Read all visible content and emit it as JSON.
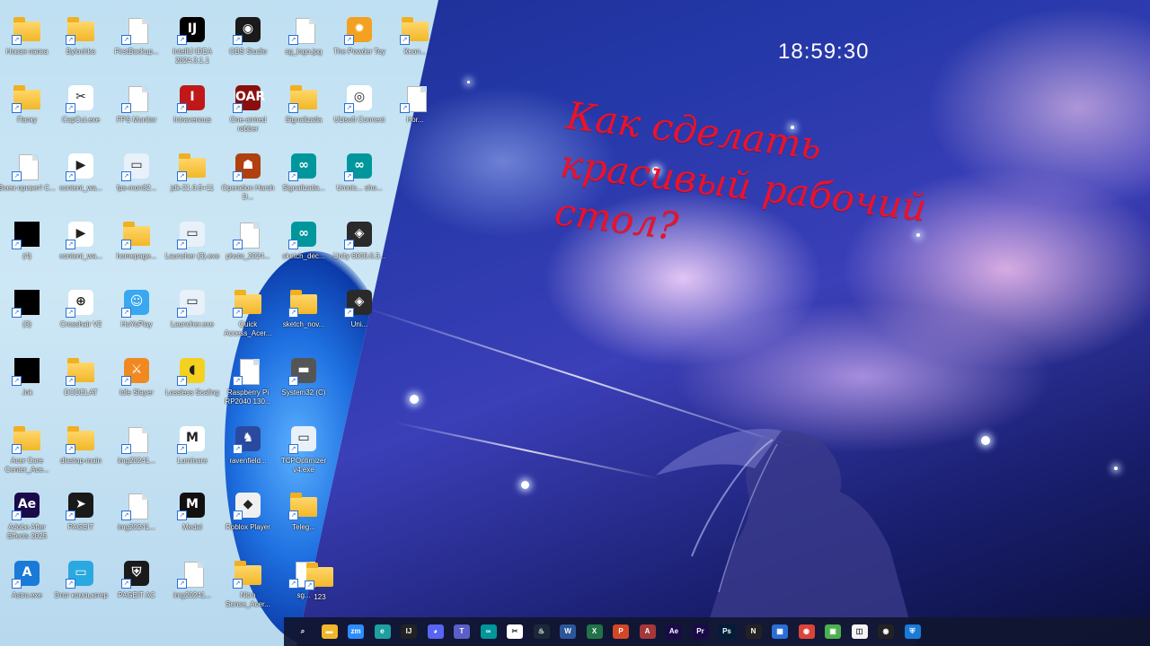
{
  "clock": {
    "time": "18:59:30"
  },
  "headline": {
    "line1": "Как сделать",
    "line2": "красивый рабочий",
    "line3": "стол?"
  },
  "colors": {
    "headline": "#e8132c",
    "folder": "#f2b728",
    "taskbar": "#101630"
  },
  "desktop_icons": [
    {
      "label": "Новая папка",
      "kind": "folder",
      "icon": "folder-icon"
    },
    {
      "label": "Bylochka",
      "kind": "folder",
      "icon": "folder-icon"
    },
    {
      "label": "FirstBackup...",
      "kind": "file",
      "icon": "file-icon"
    },
    {
      "label": "IntelliJ IDEA 2024.3.1.1",
      "kind": "app",
      "icon": "intellij-icon",
      "color": "#000000",
      "glyph": "IJ"
    },
    {
      "label": "OBS Studio",
      "kind": "app",
      "icon": "obs-icon",
      "color": "#1a1a1a",
      "glyph": "◉"
    },
    {
      "label": "sg_logo.jpg",
      "kind": "file",
      "icon": "image-file-icon"
    },
    {
      "label": "The Powder Toy",
      "kind": "app",
      "icon": "powder-toy-icon",
      "color": "#f4a020",
      "glyph": "✹"
    },
    {
      "label": "Кноп...",
      "kind": "folder",
      "icon": "folder-icon"
    },
    {
      "label": "Папку",
      "kind": "folder",
      "icon": "folder-icon"
    },
    {
      "label": "CapCut.exe",
      "kind": "app",
      "icon": "capcut-icon",
      "color": "#ffffff",
      "glyph": "✂"
    },
    {
      "label": "FPS Monitor",
      "kind": "file",
      "icon": "file-icon"
    },
    {
      "label": "Intravenous",
      "kind": "app",
      "icon": "intravenous-icon",
      "color": "#c01818",
      "glyph": "I"
    },
    {
      "label": "One-armed robber",
      "kind": "app",
      "icon": "robber-icon",
      "color": "#8a1010",
      "glyph": "OAR"
    },
    {
      "label": "Signalizatia",
      "kind": "folder",
      "icon": "folder-icon"
    },
    {
      "label": "Ubisoft Connect",
      "kind": "app",
      "icon": "ubisoft-icon",
      "color": "#ffffff",
      "glyph": "◎"
    },
    {
      "label": "Hor...",
      "kind": "file",
      "icon": "file-icon"
    },
    {
      "label": "Всем привет! С...",
      "kind": "file",
      "icon": "text-file-icon"
    },
    {
      "label": "content_wa...",
      "kind": "app",
      "icon": "video-icon",
      "color": "#ffffff",
      "glyph": "▶"
    },
    {
      "label": "fps-mon32...",
      "kind": "app",
      "icon": "exe-icon",
      "color": "#e8f0fa",
      "glyph": "▭"
    },
    {
      "label": "jdk-21.0.5+11",
      "kind": "folder",
      "icon": "folder-icon"
    },
    {
      "label": "Operation Harsh D...",
      "kind": "app",
      "icon": "operation-icon",
      "color": "#b04010",
      "glyph": "☗"
    },
    {
      "label": "Signalizatia...",
      "kind": "app",
      "icon": "arduino-icon",
      "color": "#00979c",
      "glyph": "∞"
    },
    {
      "label": "Umnic... sho...",
      "kind": "app",
      "icon": "arduino-icon",
      "color": "#00979c",
      "glyph": "∞"
    },
    {
      "label": "(4)",
      "kind": "black",
      "icon": "black-square-icon"
    },
    {
      "label": "content_wa...",
      "kind": "app",
      "icon": "video-icon",
      "color": "#ffffff",
      "glyph": "▶"
    },
    {
      "label": "homepage...",
      "kind": "folder",
      "icon": "folder-icon"
    },
    {
      "label": "Launcher (3).exe",
      "kind": "app",
      "icon": "exe-icon",
      "color": "#e8f0fa",
      "glyph": "▭"
    },
    {
      "label": "photo_2024...",
      "kind": "file",
      "icon": "image-file-icon"
    },
    {
      "label": "sketch_dec...",
      "kind": "app",
      "icon": "arduino-icon",
      "color": "#00979c",
      "glyph": "∞"
    },
    {
      "label": "Unity 6000.0.3...",
      "kind": "app",
      "icon": "unity-icon",
      "color": "#2a2a2a",
      "glyph": "◈"
    },
    {
      "label": "(3)",
      "kind": "black",
      "icon": "black-square-icon"
    },
    {
      "label": "Crosshair V2",
      "kind": "app",
      "icon": "crosshair-icon",
      "color": "#ffffff",
      "glyph": "⊕"
    },
    {
      "label": "HoYoPlay",
      "kind": "app",
      "icon": "hoyoplay-icon",
      "color": "#39a8f0",
      "glyph": "☺"
    },
    {
      "label": "Launcher.exe",
      "kind": "app",
      "icon": "exe-icon",
      "color": "#e8f0fa",
      "glyph": "▭"
    },
    {
      "label": "Quick Access_Acer...",
      "kind": "folder",
      "icon": "folder-icon"
    },
    {
      "label": "sketch_nov...",
      "kind": "folder",
      "icon": "folder-icon"
    },
    {
      "label": "Uni...",
      "kind": "app",
      "icon": "unity-icon",
      "color": "#2a2a2a",
      "glyph": "◈"
    },
    {
      "label": ".lnk",
      "kind": "black",
      "icon": "black-square-icon"
    },
    {
      "label": "DODELAT",
      "kind": "folder",
      "icon": "folder-icon"
    },
    {
      "label": "Idle Slayer",
      "kind": "app",
      "icon": "idle-slayer-icon",
      "color": "#f08a20",
      "glyph": "⚔"
    },
    {
      "label": "Lossless Scaling",
      "kind": "app",
      "icon": "duck-icon",
      "color": "#f4d020",
      "glyph": "◖"
    },
    {
      "label": "Raspberry Pi RP2040 130...",
      "kind": "file",
      "icon": "text-file-icon"
    },
    {
      "label": "System32 (C)",
      "kind": "app",
      "icon": "drive-icon",
      "color": "#555555",
      "glyph": "▬"
    },
    {
      "label": "Acer Care Center_Ace...",
      "kind": "folder",
      "icon": "folder-icon"
    },
    {
      "label": "diastop-main",
      "kind": "folder",
      "icon": "folder-icon"
    },
    {
      "label": "img20241...",
      "kind": "file",
      "icon": "image-file-icon"
    },
    {
      "label": "Luminare",
      "kind": "app",
      "icon": "luminare-icon",
      "color": "#ffffff",
      "glyph": "M"
    },
    {
      "label": "ravenfield...",
      "kind": "app",
      "icon": "ravenfield-icon",
      "color": "#2a4aa0",
      "glyph": "♞"
    },
    {
      "label": "TCPOptimizer v4.exe",
      "kind": "app",
      "icon": "exe-icon",
      "color": "#e8f0fa",
      "glyph": "▭"
    },
    {
      "label": "Adobe After Effects 2025",
      "kind": "app",
      "icon": "after-effects-icon",
      "color": "#1a0a4a",
      "glyph": "Ae"
    },
    {
      "label": "PAGEIT",
      "kind": "app",
      "icon": "pageit-icon",
      "color": "#1a1a1a",
      "glyph": "➤"
    },
    {
      "label": "img20241...",
      "kind": "file",
      "icon": "image-file-icon"
    },
    {
      "label": "Medal",
      "kind": "app",
      "icon": "medal-icon",
      "color": "#111111",
      "glyph": "M"
    },
    {
      "label": "Roblox Player",
      "kind": "app",
      "icon": "roblox-icon",
      "color": "#f0f0f0",
      "glyph": "◆"
    },
    {
      "label": "Teleg...",
      "kind": "folder",
      "icon": "folder-icon"
    },
    {
      "label": "Astro.exe",
      "kind": "app",
      "icon": "astro-icon",
      "color": "#1a7ad8",
      "glyph": "A"
    },
    {
      "label": "Этот компьютер",
      "kind": "app",
      "icon": "this-pc-icon",
      "color": "#2aa8e0",
      "glyph": "▭"
    },
    {
      "label": "PAGEIT AC",
      "kind": "app",
      "icon": "pageit-ac-icon",
      "color": "#1a1a1a",
      "glyph": "⛨"
    },
    {
      "label": "img20241...",
      "kind": "file",
      "icon": "image-file-icon"
    },
    {
      "label": "Nitro Sense_Acer...",
      "kind": "folder",
      "icon": "folder-icon"
    },
    {
      "label": "sg...",
      "kind": "file",
      "icon": "file-icon"
    },
    {
      "label": "123",
      "kind": "folder",
      "icon": "folder-icon"
    }
  ],
  "taskbar": [
    {
      "name": "search-icon",
      "glyph": "⌕",
      "color": "transparent"
    },
    {
      "name": "file-explorer-icon",
      "glyph": "▬",
      "color": "#f2b728"
    },
    {
      "name": "zoom-icon",
      "glyph": "zm",
      "color": "#2d8cff"
    },
    {
      "name": "edge-icon",
      "glyph": "e",
      "color": "#1fa0a0"
    },
    {
      "name": "intellij-icon",
      "glyph": "IJ",
      "color": "#222222"
    },
    {
      "name": "discord-icon",
      "glyph": "◕",
      "color": "#5865f2"
    },
    {
      "name": "teams-icon",
      "glyph": "T",
      "color": "#5b5fc7"
    },
    {
      "name": "arduino-icon",
      "glyph": "∞",
      "color": "#00979c"
    },
    {
      "name": "capcut-icon",
      "glyph": "✂",
      "color": "#ffffff"
    },
    {
      "name": "steam-icon",
      "glyph": "♨",
      "color": "#1b2838"
    },
    {
      "name": "word-icon",
      "glyph": "W",
      "color": "#2b579a"
    },
    {
      "name": "excel-icon",
      "glyph": "X",
      "color": "#217346"
    },
    {
      "name": "powerpoint-icon",
      "glyph": "P",
      "color": "#d24726"
    },
    {
      "name": "access-icon",
      "glyph": "A",
      "color": "#a4373a"
    },
    {
      "name": "after-effects-icon",
      "glyph": "Ae",
      "color": "#1a0a4a"
    },
    {
      "name": "premiere-icon",
      "glyph": "Pr",
      "color": "#1a0a4a"
    },
    {
      "name": "photoshop-icon",
      "glyph": "Ps",
      "color": "#001e36"
    },
    {
      "name": "notion-icon",
      "glyph": "N",
      "color": "#222222"
    },
    {
      "name": "widgets-icon",
      "glyph": "▦",
      "color": "#2a6fd6"
    },
    {
      "name": "chrome-icon",
      "glyph": "◉",
      "color": "#db4437"
    },
    {
      "name": "minecraft-icon",
      "glyph": "▣",
      "color": "#4caf50"
    },
    {
      "name": "store-icon",
      "glyph": "◫",
      "color": "#f4f4f4"
    },
    {
      "name": "obs-icon",
      "glyph": "◉",
      "color": "#222222"
    },
    {
      "name": "defender-icon",
      "glyph": "⛨",
      "color": "#1a7ad8"
    }
  ]
}
